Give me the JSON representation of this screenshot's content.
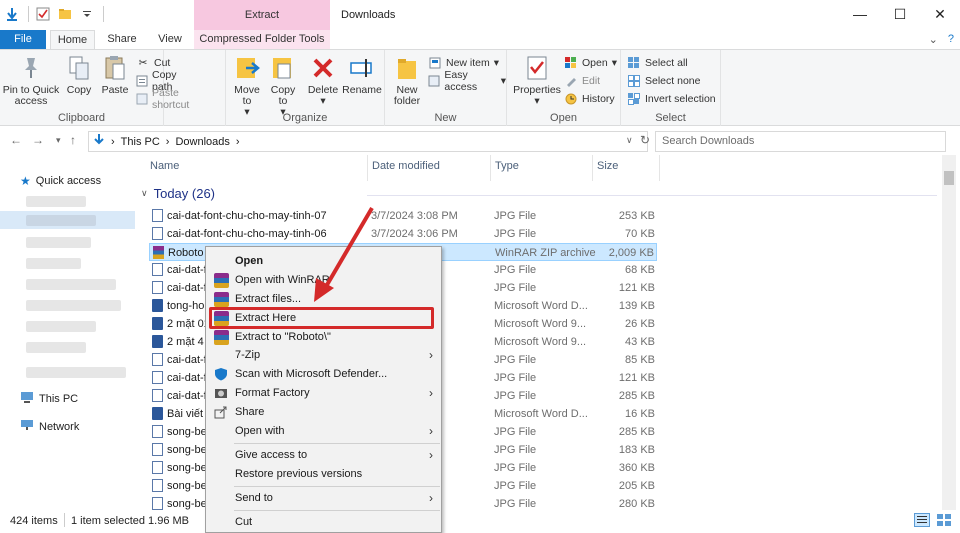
{
  "window": {
    "title": "Downloads",
    "context_tab_header": "Extract",
    "controls": [
      "—",
      "☐",
      "✕"
    ]
  },
  "tabs": {
    "file": "File",
    "home": "Home",
    "share": "Share",
    "view": "View",
    "compressed": "Compressed Folder Tools"
  },
  "ribbon": {
    "clipboard": {
      "label": "Clipboard",
      "pin": "Pin to Quick access",
      "copy": "Copy",
      "paste": "Paste",
      "cut": "Cut",
      "copy_path": "Copy path",
      "paste_shortcut": "Paste shortcut"
    },
    "organize": {
      "label": "Organize",
      "move_to": "Move to",
      "copy_to": "Copy to",
      "delete": "Delete",
      "rename": "Rename"
    },
    "new": {
      "label": "New",
      "new_folder": "New folder",
      "new_item": "New item",
      "easy_access": "Easy access"
    },
    "open": {
      "label": "Open",
      "properties": "Properties",
      "open": "Open",
      "edit": "Edit",
      "history": "History"
    },
    "select": {
      "label": "Select",
      "select_all": "Select all",
      "select_none": "Select none",
      "invert": "Invert selection"
    }
  },
  "address": {
    "this_pc": "This PC",
    "downloads": "Downloads",
    "search_placeholder": "Search Downloads"
  },
  "nav": {
    "quick_access": "Quick access",
    "this_pc": "This PC",
    "network": "Network"
  },
  "columns": {
    "name": "Name",
    "date": "Date modified",
    "type": "Type",
    "size": "Size"
  },
  "group": {
    "label": "Today (26)"
  },
  "files": [
    {
      "name": "cai-dat-font-chu-cho-may-tinh-07",
      "date": "3/7/2024 3:08 PM",
      "type": "JPG File",
      "size": "253 KB",
      "icon": "jpg"
    },
    {
      "name": "cai-dat-font-chu-cho-may-tinh-06",
      "date": "3/7/2024 3:06 PM",
      "type": "JPG File",
      "size": "70 KB",
      "icon": "jpg"
    },
    {
      "name": "Roboto",
      "date": "M",
      "type": "WinRAR ZIP archive",
      "size": "2,009 KB",
      "icon": "zip"
    },
    {
      "name": "cai-dat-f",
      "date": "",
      "type": "JPG File",
      "size": "68 KB",
      "icon": "jpg"
    },
    {
      "name": "cai-dat-f",
      "date": "",
      "type": "JPG File",
      "size": "121 KB",
      "icon": "jpg"
    },
    {
      "name": "tong-ho",
      "date": "",
      "type": "Microsoft Word D...",
      "size": "139 KB",
      "icon": "doc"
    },
    {
      "name": "2 mặt 01",
      "date": "",
      "type": "Microsoft Word 9...",
      "size": "26 KB",
      "icon": "doc"
    },
    {
      "name": "2 mặt 4 l",
      "date": "",
      "type": "Microsoft Word 9...",
      "size": "43 KB",
      "icon": "doc"
    },
    {
      "name": "cai-dat-f",
      "date": "",
      "type": "JPG File",
      "size": "85 KB",
      "icon": "jpg"
    },
    {
      "name": "cai-dat-f",
      "date": "",
      "type": "JPG File",
      "size": "121 KB",
      "icon": "jpg"
    },
    {
      "name": "cai-dat-f",
      "date": "",
      "type": "JPG File",
      "size": "285 KB",
      "icon": "jpg"
    },
    {
      "name": "Bài viết (",
      "date": "",
      "type": "Microsoft Word D...",
      "size": "16 KB",
      "icon": "doc"
    },
    {
      "name": "song-be",
      "date": "PM",
      "type": "JPG File",
      "size": "285 KB",
      "icon": "jpg"
    },
    {
      "name": "song-be",
      "date": "PM",
      "type": "JPG File",
      "size": "183 KB",
      "icon": "jpg"
    },
    {
      "name": "song-be",
      "date": "PM",
      "type": "JPG File",
      "size": "360 KB",
      "icon": "jpg"
    },
    {
      "name": "song-be",
      "date": "PM",
      "type": "JPG File",
      "size": "205 KB",
      "icon": "jpg"
    },
    {
      "name": "song-be",
      "date": "PM",
      "type": "JPG File",
      "size": "280 KB",
      "icon": "jpg"
    }
  ],
  "status": {
    "items": "424 items",
    "selected": "1 item selected  1.96 MB"
  },
  "context_menu": {
    "open": "Open",
    "open_winrar": "Open with WinRAR",
    "extract_files": "Extract files...",
    "extract_here": "Extract Here",
    "extract_to": "Extract to \"Roboto\\\"",
    "seven_zip": "7-Zip",
    "defender": "Scan with Microsoft Defender...",
    "format_factory": "Format Factory",
    "share": "Share",
    "open_with": "Open with",
    "give_access": "Give access to",
    "restore": "Restore previous versions",
    "send_to": "Send to",
    "cut": "Cut"
  },
  "colors": {
    "accent": "#1979ca",
    "selection": "#cce8ff",
    "highlight": "#d42a2a",
    "context_tab": "#f7c8e0"
  }
}
